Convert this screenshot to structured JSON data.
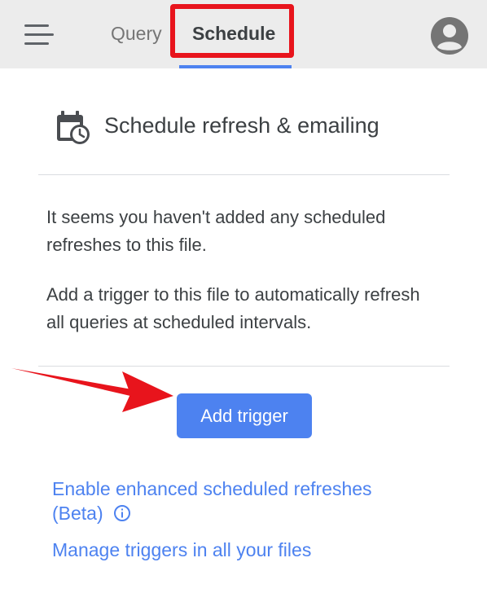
{
  "header": {
    "tabs": [
      {
        "label": "Query",
        "active": false
      },
      {
        "label": "Schedule",
        "active": true
      }
    ],
    "menu_icon": "hamburger-menu-icon",
    "avatar_icon": "account-circle-icon"
  },
  "card": {
    "icon": "calendar-clock-icon",
    "title": "Schedule refresh & emailing",
    "empty_message": "It seems you haven't added any scheduled refreshes to this file.",
    "instructions": "Add a trigger to this file to automatically refresh all queries at scheduled intervals.",
    "add_button_label": "Add trigger"
  },
  "links": {
    "enhanced_line1": "Enable enhanced scheduled refreshes",
    "enhanced_line2": "(Beta)",
    "info_icon": "info-circle-icon",
    "manage": "Manage triggers in all your files"
  },
  "colors": {
    "accent": "#4d82f0",
    "highlight": "#e8141c",
    "topbar_bg": "#ececec",
    "text": "#3c4043"
  }
}
